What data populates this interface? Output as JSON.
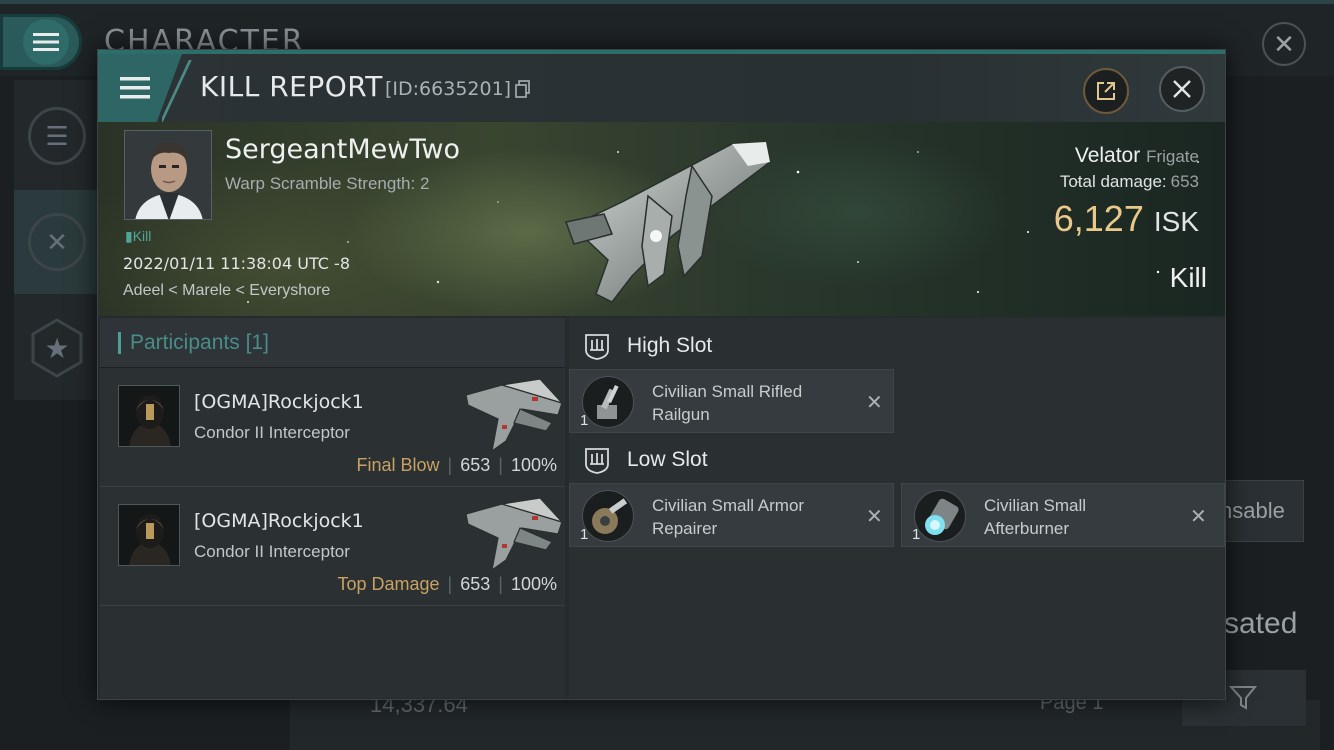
{
  "background": {
    "title": "CHARACTER",
    "right_fragment_1": "nsable",
    "right_fragment_2": "sated",
    "bottom_value": "14,337.64",
    "bottom_page": "Page 1"
  },
  "dialog": {
    "title": "KILL REPORT",
    "report_id": "[ID:6635201]",
    "victim": {
      "name": "SergeantMewTwo",
      "warp_scramble": "Warp Scramble Strength: 2",
      "tag": "Kill",
      "timestamp": "2022/01/11 11:38:04 UTC -8",
      "location": "Adeel < Marele < Everyshore"
    },
    "ship": {
      "name": "Velator",
      "class": "Frigate",
      "total_damage_label": "Total damage:",
      "total_damage_value": "653",
      "isk_value": "6,127",
      "isk_unit": "ISK",
      "result": "Kill"
    },
    "participants": {
      "title": "Participants",
      "count": "[1]",
      "rows": [
        {
          "name": "[OGMA]Rockjock1",
          "ship": "Condor II Interceptor",
          "label": "Final Blow",
          "damage": "653",
          "percent": "100%"
        },
        {
          "name": "[OGMA]Rockjock1",
          "ship": "Condor II Interceptor",
          "label": "Top Damage",
          "damage": "653",
          "percent": "100%"
        }
      ]
    },
    "slots": {
      "high": {
        "title": "High Slot",
        "modules": [
          {
            "name": "Civilian Small Rifled Railgun",
            "qty": "1"
          }
        ]
      },
      "low": {
        "title": "Low Slot",
        "modules": [
          {
            "name": "Civilian Small Armor Repairer",
            "qty": "1"
          },
          {
            "name": "Civilian Small Afterburner",
            "qty": "1"
          }
        ]
      }
    }
  },
  "colors": {
    "accent": "#2d6664",
    "isk": "#e8c98a",
    "participant_label": "#c9a262",
    "participants_title": "#4a8c88"
  },
  "icons": {
    "menu": "hamburger-icon",
    "close": "close-icon",
    "share": "share-icon",
    "copy": "copy-icon",
    "slot": "slot-icon",
    "remove": "close-icon"
  }
}
